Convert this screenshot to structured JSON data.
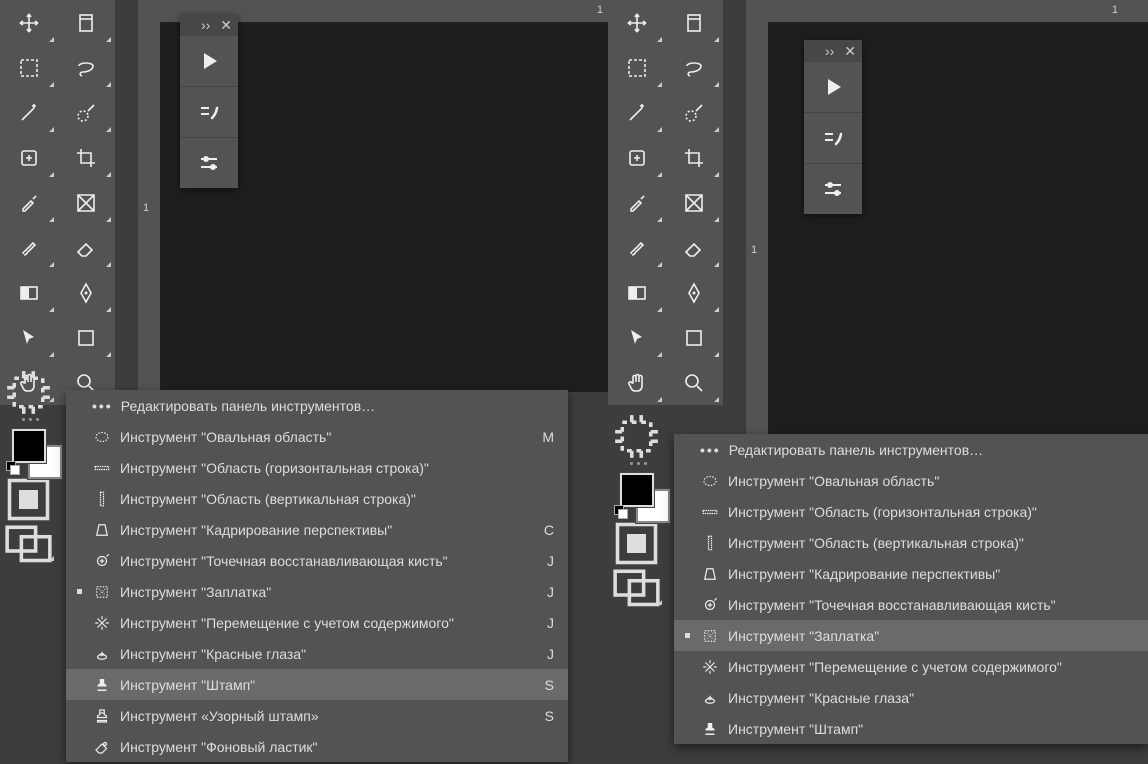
{
  "left": {
    "ruler_h_mark": "1",
    "ruler_v_mark": "1",
    "tools_rows": [
      [
        "move",
        "artboard"
      ],
      [
        "marquee",
        "lasso"
      ],
      [
        "wand",
        "quicksel"
      ],
      [
        "heal",
        "crop"
      ],
      [
        "eyedrop",
        "frame"
      ],
      [
        "brush",
        "eraser"
      ],
      [
        "gradient",
        "pen"
      ],
      [
        "pointer",
        "shape"
      ],
      [
        "hand",
        "zoom"
      ]
    ],
    "menu": {
      "header": "Редактировать панель инструментов…",
      "items": [
        {
          "icon": "ellipse",
          "label": "Инструмент \"Овальная область\"",
          "sc": "M",
          "sel": false
        },
        {
          "icon": "rowsel",
          "label": "Инструмент \"Область (горизонтальная строка)\"",
          "sc": "",
          "sel": false
        },
        {
          "icon": "colsel",
          "label": "Инструмент \"Область (вертикальная строка)\"",
          "sc": "",
          "sel": false
        },
        {
          "icon": "perspcrop",
          "label": "Инструмент \"Кадрирование перспективы\"",
          "sc": "C",
          "sel": false
        },
        {
          "icon": "spotheal",
          "label": "Инструмент \"Точечная восстанавливающая кисть\"",
          "sc": "J",
          "sel": false
        },
        {
          "icon": "patch",
          "label": "Инструмент \"Заплатка\"",
          "sc": "J",
          "sel": true
        },
        {
          "icon": "contentmove",
          "label": "Инструмент \"Перемещение с учетом содержимого\"",
          "sc": "J",
          "sel": false
        },
        {
          "icon": "redeye",
          "label": "Инструмент \"Красные глаза\"",
          "sc": "J",
          "sel": false
        },
        {
          "icon": "stamp",
          "label": "Инструмент \"Штамп\"",
          "sc": "S",
          "sel": false,
          "hi": true
        },
        {
          "icon": "patternstamp",
          "label": "Инструмент «Узорный штамп»",
          "sc": "S",
          "sel": false
        },
        {
          "icon": "bgeraser",
          "label": "Инструмент \"Фоновый ластик\"",
          "sc": "",
          "sel": false
        }
      ]
    }
  },
  "right": {
    "ruler_h_mark": "1",
    "ruler_v_mark": "1",
    "tools_rows": [
      [
        "move",
        "artboard"
      ],
      [
        "marquee",
        "lasso"
      ],
      [
        "wand",
        "quicksel"
      ],
      [
        "heal",
        "crop"
      ],
      [
        "eyedrop",
        "frame"
      ],
      [
        "brush",
        "eraser"
      ],
      [
        "gradient",
        "pen"
      ],
      [
        "pointer",
        "shape"
      ],
      [
        "hand",
        "zoom"
      ]
    ],
    "menu": {
      "header": "Редактировать панель инструментов…",
      "items": [
        {
          "icon": "ellipse",
          "label": "Инструмент \"Овальная область\"",
          "sc": "",
          "sel": false
        },
        {
          "icon": "rowsel",
          "label": "Инструмент \"Область (горизонтальная строка)\"",
          "sc": "",
          "sel": false
        },
        {
          "icon": "colsel",
          "label": "Инструмент \"Область (вертикальная строка)\"",
          "sc": "",
          "sel": false
        },
        {
          "icon": "perspcrop",
          "label": "Инструмент \"Кадрирование перспективы\"",
          "sc": "",
          "sel": false
        },
        {
          "icon": "spotheal",
          "label": "Инструмент \"Точечная восстанавливающая кисть\"",
          "sc": "",
          "sel": false
        },
        {
          "icon": "patch",
          "label": "Инструмент \"Заплатка\"",
          "sc": "",
          "sel": true,
          "hi": true
        },
        {
          "icon": "contentmove",
          "label": "Инструмент \"Перемещение с учетом содержимого\"",
          "sc": "",
          "sel": false
        },
        {
          "icon": "redeye",
          "label": "Инструмент \"Красные глаза\"",
          "sc": "",
          "sel": false
        },
        {
          "icon": "stamp",
          "label": "Инструмент \"Штамп\"",
          "sc": "",
          "sel": false
        }
      ]
    }
  },
  "icons": {
    "move": "move-tool-icon",
    "artboard": "artboard-tool-icon",
    "marquee": "marquee-tool-icon",
    "lasso": "lasso-tool-icon",
    "wand": "magic-wand-tool-icon",
    "quicksel": "quick-selection-tool-icon",
    "heal": "healing-brush-tool-icon",
    "crop": "crop-tool-icon",
    "eyedrop": "eyedropper-tool-icon",
    "frame": "frame-tool-icon",
    "brush": "brush-tool-icon",
    "eraser": "eraser-tool-icon",
    "gradient": "gradient-tool-icon",
    "pen": "pen-tool-icon",
    "pointer": "path-selection-tool-icon",
    "shape": "rectangle-tool-icon",
    "hand": "hand-tool-icon",
    "zoom": "zoom-tool-icon",
    "ellipse": "elliptical-marquee-icon",
    "rowsel": "row-marquee-icon",
    "colsel": "column-marquee-icon",
    "perspcrop": "perspective-crop-icon",
    "spotheal": "spot-healing-icon",
    "patch": "patch-tool-icon",
    "contentmove": "content-aware-move-icon",
    "redeye": "red-eye-tool-icon",
    "stamp": "clone-stamp-icon",
    "patternstamp": "pattern-stamp-icon",
    "bgeraser": "background-eraser-icon"
  }
}
